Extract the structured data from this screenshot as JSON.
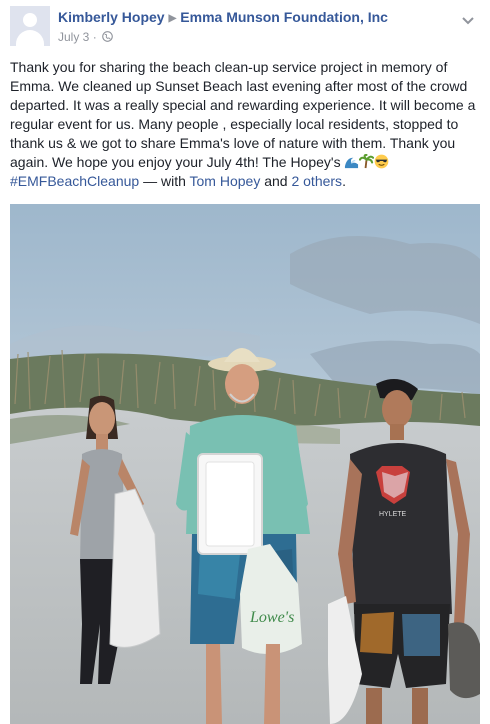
{
  "header": {
    "author": "Kimberly Hopey",
    "page": "Emma Munson Foundation, Inc",
    "date": "July 3",
    "separator": "·"
  },
  "post": {
    "body": "Thank you for sharing the beach clean-up service project in memory of Emma. We cleaned up Sunset Beach last evening after most of the crowd departed. It was a really special and rewarding experience. It will become a regular event for us. Many people , especially local residents, stopped to thank us & we got to share Emma's love of nature with them. Thank you again. We hope you enjoy your July 4th! The Hopey's",
    "hashtag": "#EMFBeachCleanup",
    "with_text": "— with",
    "tagged_person": "Tom Hopey",
    "and_text": "and",
    "others": "2 others",
    "end": "."
  },
  "photo": {
    "shirt_text": "HYLETE",
    "bag_text": "Lowe's"
  },
  "colors": {
    "link": "#365899",
    "meta": "#90949c",
    "text": "#1d2129"
  },
  "icons": [
    "globe-icon",
    "chevron-down-icon",
    "wave-emoji",
    "palm-tree-emoji",
    "sunglasses-emoji"
  ]
}
